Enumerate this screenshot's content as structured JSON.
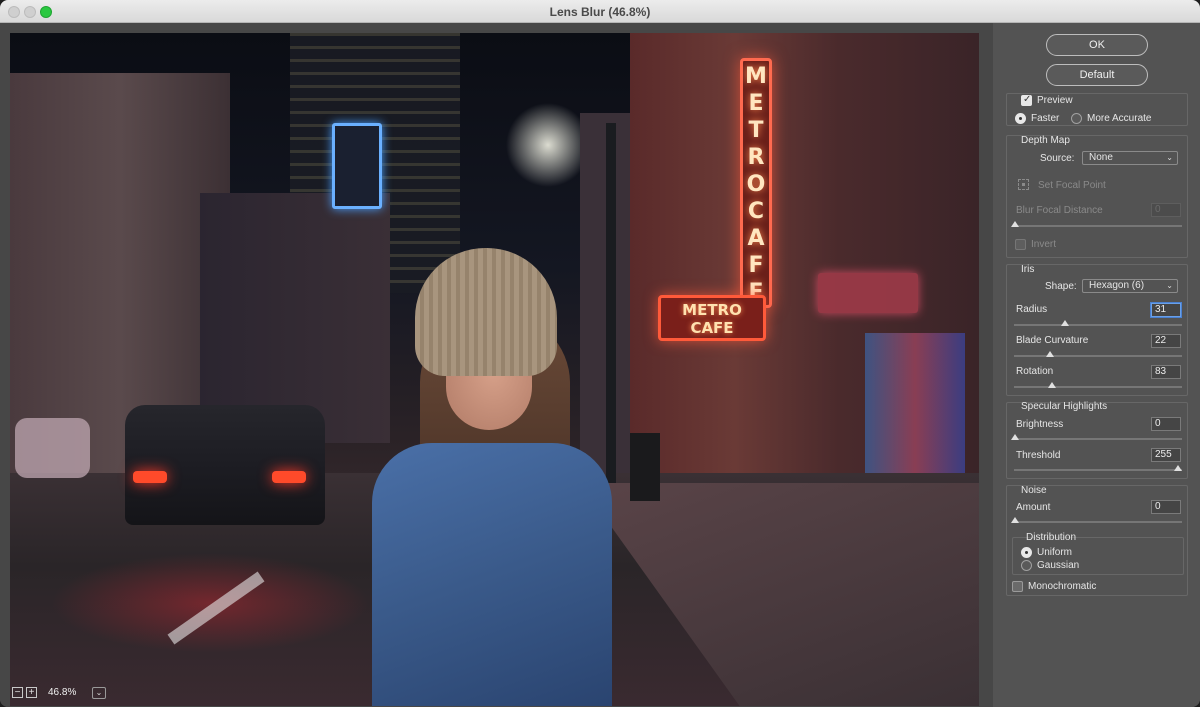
{
  "window": {
    "title": "Lens Blur (46.8%)"
  },
  "preview": {
    "sign_vertical": "METRO CAFE",
    "sign_horizontal": "METRO CAFE",
    "zoom_level": "46.8%",
    "zoom_out_icon": "minus-icon",
    "zoom_in_icon": "plus-icon"
  },
  "buttons": {
    "ok": "OK",
    "default": "Default"
  },
  "preview_options": {
    "preview_label": "Preview",
    "preview_checked": true,
    "faster_label": "Faster",
    "more_accurate_label": "More Accurate",
    "selected_mode": "Faster"
  },
  "depth_map": {
    "title": "Depth Map",
    "source_label": "Source:",
    "source_value": "None",
    "set_focal_point_label": "Set Focal Point",
    "blur_focal_distance_label": "Blur Focal Distance",
    "blur_focal_distance_value": "0",
    "invert_label": "Invert",
    "invert_checked": false
  },
  "iris": {
    "title": "Iris",
    "shape_label": "Shape:",
    "shape_value": "Hexagon (6)",
    "radius_label": "Radius",
    "radius_value": "31",
    "blade_curvature_label": "Blade Curvature",
    "blade_curvature_value": "22",
    "rotation_label": "Rotation",
    "rotation_value": "83"
  },
  "specular_highlights": {
    "title": "Specular Highlights",
    "brightness_label": "Brightness",
    "brightness_value": "0",
    "threshold_label": "Threshold",
    "threshold_value": "255"
  },
  "noise": {
    "title": "Noise",
    "amount_label": "Amount",
    "amount_value": "0",
    "distribution_title": "Distribution",
    "uniform_label": "Uniform",
    "gaussian_label": "Gaussian",
    "selected_distribution": "Uniform",
    "monochromatic_label": "Monochromatic",
    "monochromatic_checked": false
  },
  "colors": {
    "panel_bg": "#535353",
    "focus_ring": "#4a80d0",
    "maximize_button": "#2ac840"
  }
}
